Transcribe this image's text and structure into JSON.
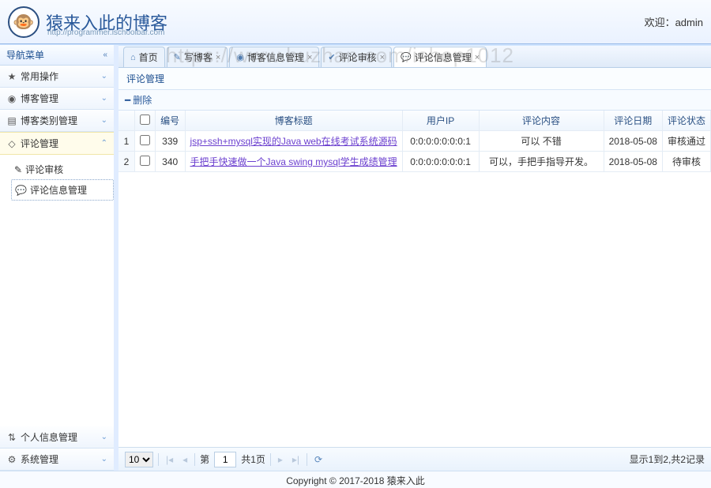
{
  "header": {
    "site_title": "猿来入此的博客",
    "site_sub": "http://programmer.ischoolbar.com",
    "welcome_prefix": "欢迎：",
    "welcome_user": "admin"
  },
  "watermark": "https://www.huzhan.com/ishop1012",
  "sidebar": {
    "title": "导航菜单",
    "items": [
      {
        "icon": "★",
        "label": "常用操作"
      },
      {
        "icon": "◉",
        "label": "博客管理"
      },
      {
        "icon": "▤",
        "label": "博客类别管理"
      },
      {
        "icon": "◇",
        "label": "评论管理",
        "selected": true
      },
      {
        "icon": "⇅",
        "label": "个人信息管理"
      },
      {
        "icon": "⚙",
        "label": "系统管理"
      }
    ],
    "submenu": [
      {
        "icon": "✎",
        "label": "评论审核"
      },
      {
        "icon": "💬",
        "label": "评论信息管理",
        "active": true
      }
    ]
  },
  "tabs": [
    {
      "icon": "⌂",
      "label": "首页"
    },
    {
      "icon": "✎",
      "label": "写博客",
      "closable": true
    },
    {
      "icon": "◉",
      "label": "博客信息管理",
      "closable": true
    },
    {
      "icon": "✔",
      "label": "评论审核",
      "closable": true
    },
    {
      "icon": "💬",
      "label": "评论信息管理",
      "closable": true,
      "active": true
    }
  ],
  "panel": {
    "title": "评论管理",
    "toolbar_delete": "删除"
  },
  "grid": {
    "columns": [
      "",
      "",
      "编号",
      "博客标题",
      "用户IP",
      "评论内容",
      "评论日期",
      "评论状态"
    ],
    "rows": [
      {
        "n": "1",
        "id": "339",
        "title": "jsp+ssh+mysql实现的Java web在线考试系统源码",
        "ip": "0:0:0:0:0:0:0:1",
        "content": "可以 不错",
        "date": "2018-05-08",
        "status": "审核通过"
      },
      {
        "n": "2",
        "id": "340",
        "title": "手把手快速做一个Java swing mysql学生成绩管理",
        "ip": "0:0:0:0:0:0:0:1",
        "content": "可以，手把手指导开发。",
        "date": "2018-05-08",
        "status": "待审核"
      }
    ]
  },
  "pager": {
    "size": "10",
    "page_prefix": "第",
    "page": "1",
    "page_suffix": "共1页",
    "info": "显示1到2,共2记录"
  },
  "footer": "Copyright © 2017-2018 猿来入此"
}
